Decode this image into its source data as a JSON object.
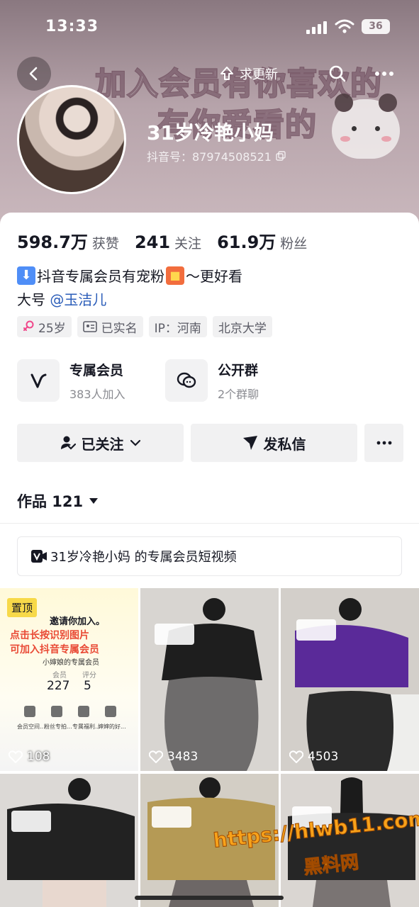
{
  "status_bar": {
    "time": "13:33",
    "battery": "36"
  },
  "header": {
    "banner_line1": "加入会员有你喜欢的",
    "banner_line2": "有你爱看的",
    "update_label": "求更新",
    "nickname": "31岁冷艳小妈",
    "douyin_id": "抖音号：87974508521"
  },
  "stats": [
    {
      "value": "598.7万",
      "label": "获赞"
    },
    {
      "value": "241",
      "label": "关注"
    },
    {
      "value": "61.9万",
      "label": "粉丝"
    }
  ],
  "bio": {
    "line1": "抖音专属会员有宠粉",
    "line1_end": "～更好看",
    "line2_prefix": "大号",
    "mention": "@玉洁儿"
  },
  "tags": [
    "25岁",
    "已实名",
    "IP：河南",
    "北京大学"
  ],
  "features": [
    {
      "title": "专属会员",
      "subtitle": "383人加入"
    },
    {
      "title": "公开群",
      "subtitle": "2个群聊"
    }
  ],
  "actions": {
    "follow": "已关注",
    "message": "发私信"
  },
  "works": {
    "label": "作品 121"
  },
  "vip_bar": {
    "text": "31岁冷艳小妈 的专属会员短视频"
  },
  "videos": [
    {
      "likes": "108",
      "pinned": "置顶"
    },
    {
      "likes": "3483"
    },
    {
      "likes": "4503"
    },
    {
      "likes": ""
    },
    {
      "likes": ""
    },
    {
      "likes": ""
    }
  ],
  "promo_card": {
    "invite": "邀请你加入。",
    "line1": "点击长按识别图片",
    "line2": "可加入抖音专属会员",
    "sub": "小婶娘的专属会员",
    "stat1_label": "会员",
    "stat1_value": "227",
    "stat2_label": "评分",
    "stat2_value": "5",
    "menu": [
      "会员空间...",
      "粉丝专拍...",
      "专属福利...",
      "婶婶的好..."
    ]
  },
  "watermark": {
    "url": "https://hlwb11.com",
    "name": "黑料网"
  },
  "colors": {
    "accent_link": "#2b5db9",
    "pin": "#f7d949",
    "watermark": "#f7a21a"
  }
}
